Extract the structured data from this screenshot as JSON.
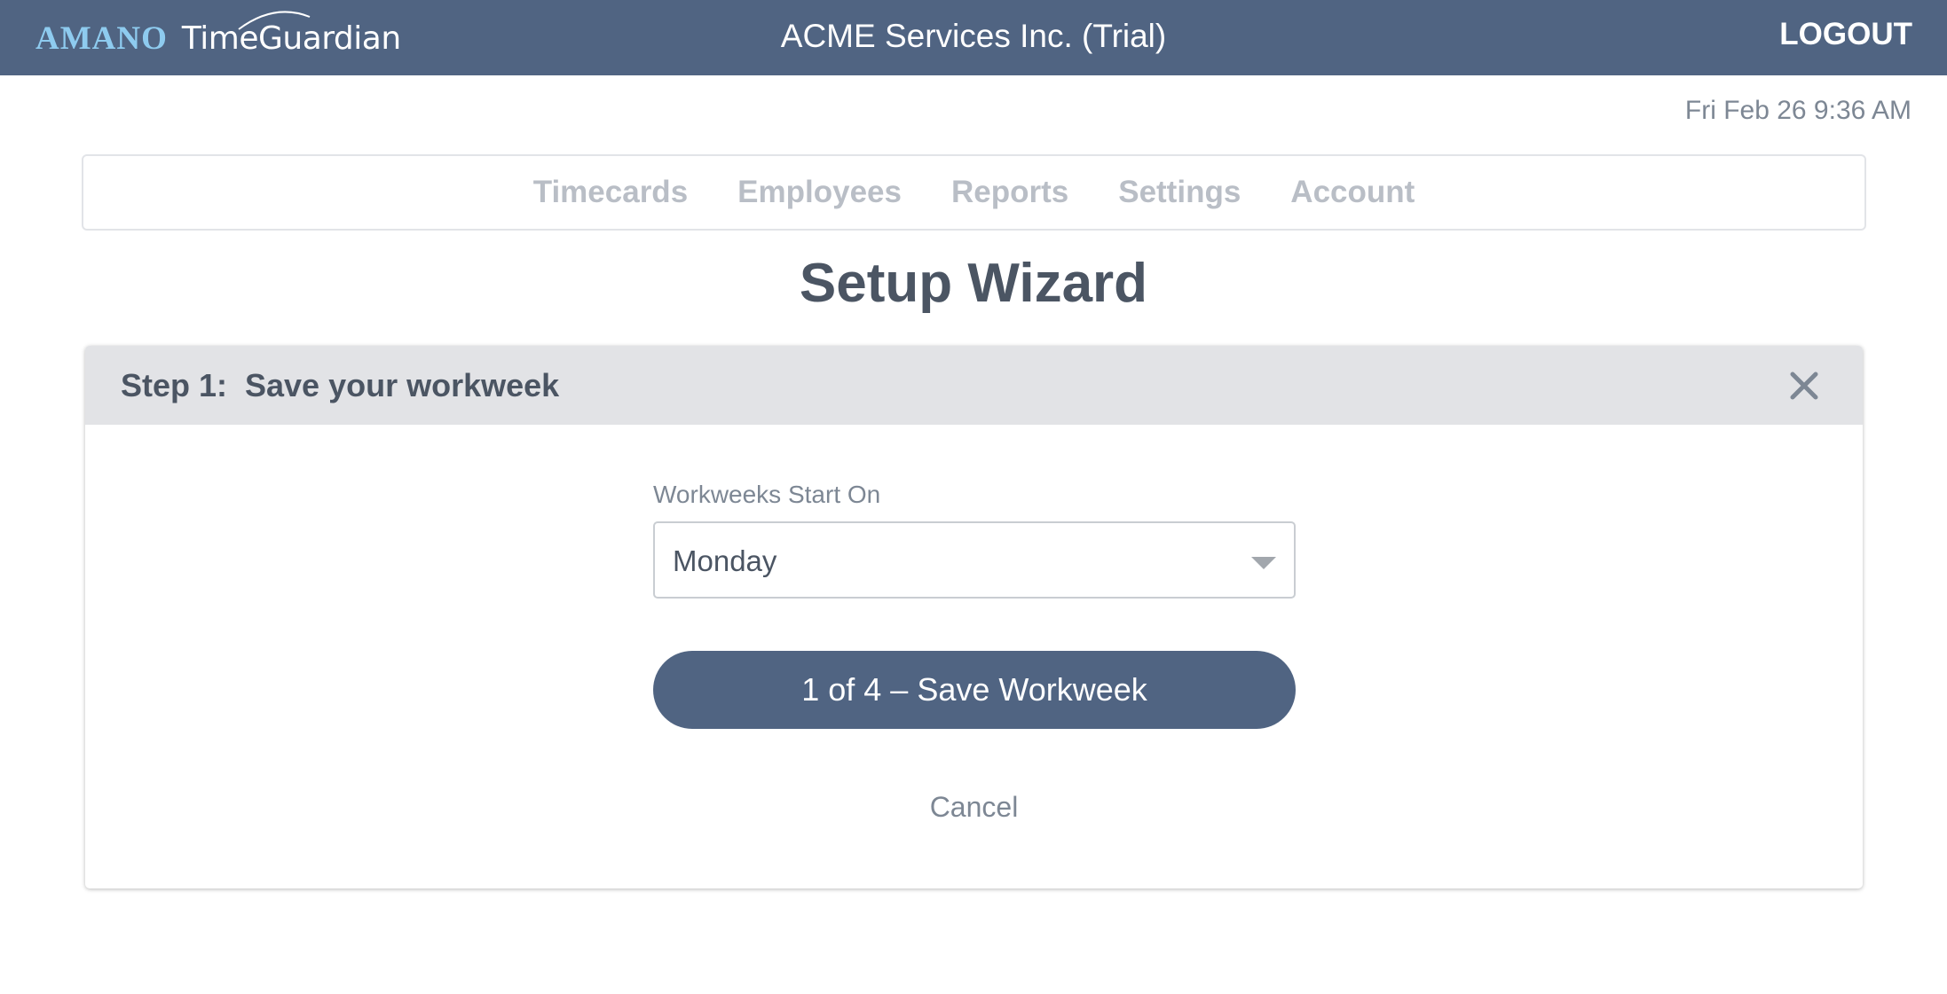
{
  "header": {
    "logo": {
      "brand": "AMANO",
      "product": "TimeGuardian"
    },
    "company": "ACME Services Inc. (Trial)",
    "logout_label": "LOGOUT"
  },
  "datetime": "Fri Feb 26 9:36 AM",
  "nav": {
    "items": [
      {
        "label": "Timecards"
      },
      {
        "label": "Employees"
      },
      {
        "label": "Reports"
      },
      {
        "label": "Settings"
      },
      {
        "label": "Account"
      }
    ]
  },
  "page_title": "Setup Wizard",
  "wizard": {
    "step_label": "Step 1:",
    "step_title": "Save your workweek",
    "close_icon": "close-icon",
    "field_label": "Workweeks Start On",
    "select_value": "Monday",
    "primary_button": "1 of 4 – Save Workweek",
    "cancel_label": "Cancel"
  },
  "colors": {
    "header_bg": "#506482",
    "logo_accent": "#8ecbef",
    "primary_button_bg": "#506482",
    "card_header_bg": "#e2e3e6",
    "nav_text": "#b9bec6"
  }
}
